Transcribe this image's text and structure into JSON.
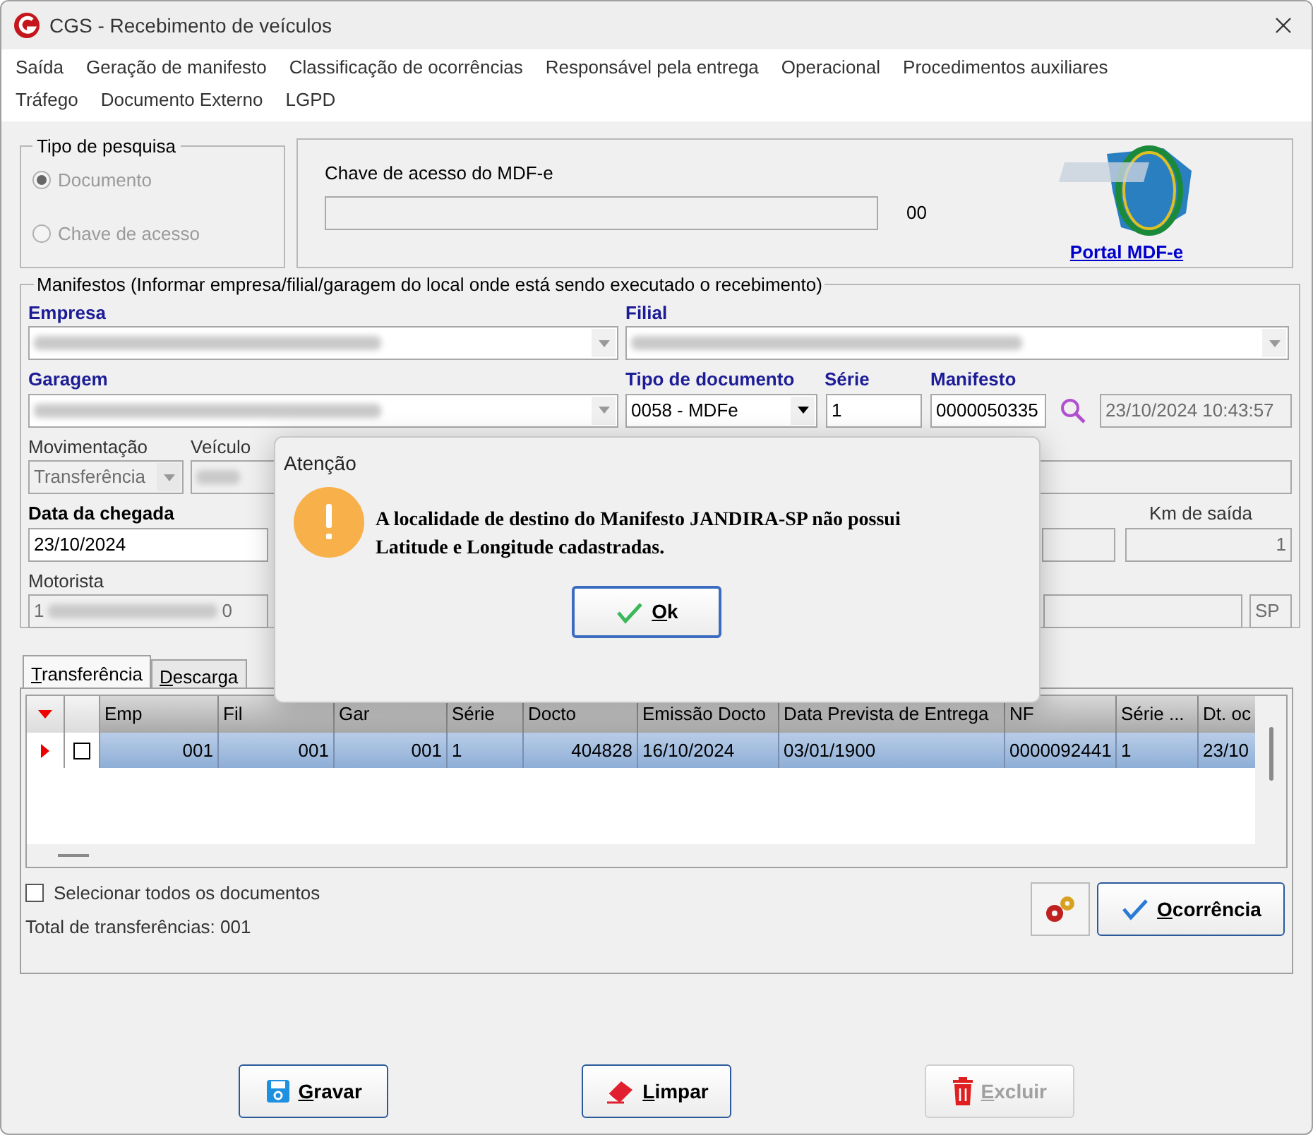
{
  "window": {
    "title": "CGS - Recebimento de veículos"
  },
  "menu": [
    "Saída",
    "Geração de manifesto",
    "Classificação de ocorrências",
    "Responsável pela entrega",
    "Operacional",
    "Procedimentos auxiliares",
    "Tráfego",
    "Documento Externo",
    "LGPD"
  ],
  "search_type": {
    "legend": "Tipo de pesquisa",
    "options": [
      {
        "label": "Documento",
        "selected": true
      },
      {
        "label": "Chave de acesso",
        "selected": false
      }
    ],
    "disabled": true
  },
  "mdfe": {
    "label": "Chave de acesso do MDF-e",
    "count": "00",
    "link": "Portal MDF-e"
  },
  "manifestos": {
    "legend": "Manifestos (Informar empresa/filial/garagem do local onde está sendo executado o recebimento)",
    "labels": {
      "empresa": "Empresa",
      "filial": "Filial",
      "garagem": "Garagem",
      "tipo": "Tipo de documento",
      "serie": "Série",
      "manifesto": "Manifesto",
      "movimentacao": "Movimentação",
      "veiculo": "Veículo",
      "data_chegada": "Data da chegada",
      "km_saida": "Km de saída",
      "motorista": "Motorista"
    },
    "tipo_value": "0058 - MDFe",
    "serie_value": "1",
    "manifesto_value": "0000050335",
    "manifesto_date": "23/10/2024 10:43:57",
    "movimentacao_value": "Transferência",
    "data_chegada_value": "23/10/2024",
    "km_saida_value": "1",
    "motorista_suffix": "0",
    "uf_value": "SP",
    "motorista_prefix": "1"
  },
  "tabs": [
    {
      "label": "Transferência",
      "selected": true
    },
    {
      "label": "Descarga",
      "selected": false
    }
  ],
  "table": {
    "columns": [
      "Emp",
      "Fil",
      "Gar",
      "Série",
      "Docto",
      "Emissão Docto",
      "Data Prevista de Entrega",
      "NF",
      "Série ...",
      "Dt. oc"
    ],
    "rows": [
      {
        "selected": true,
        "checked": false,
        "cells": [
          "001",
          "001",
          "001",
          "1",
          "404828",
          "16/10/2024",
          "03/01/1900",
          "0000092441",
          "1",
          "23/10"
        ]
      }
    ]
  },
  "select_all": {
    "label": "Selecionar todos os documentos",
    "checked": false
  },
  "total": "Total de transferências: 001",
  "occurrence_button": "Ocorrência",
  "buttons": [
    {
      "kind": "save",
      "label": "Gravar",
      "disabled": false
    },
    {
      "kind": "clear",
      "label": "Limpar",
      "disabled": false
    },
    {
      "kind": "delete",
      "label": "Excluir",
      "disabled": true
    }
  ],
  "dialog": {
    "title": "Atenção",
    "message": "A localidade de destino do Manifesto JANDIRA-SP não possui Latitude e Longitude cadastradas.",
    "ok": "Ok"
  }
}
